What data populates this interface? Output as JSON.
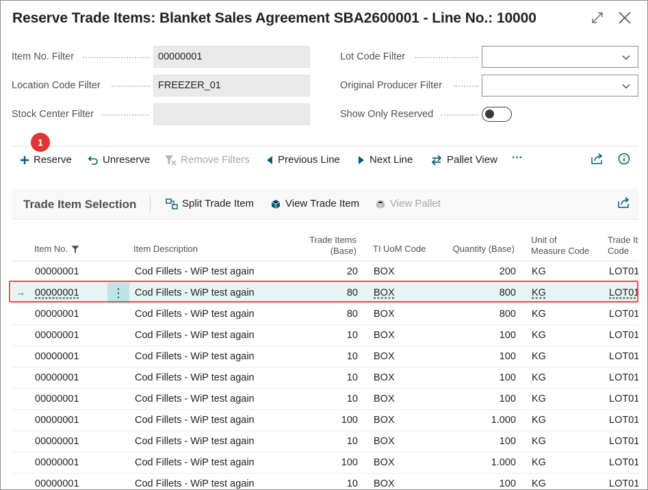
{
  "window": {
    "title": "Reserve Trade Items: Blanket Sales Agreement SBA2600001 - Line No.: 10000",
    "expand_icon": "expand-icon",
    "close_icon": "close-icon"
  },
  "filters": {
    "item_no": {
      "label": "Item No. Filter",
      "value": "00000001"
    },
    "location_code": {
      "label": "Location Code Filter",
      "value": "FREEZER_01"
    },
    "stock_center": {
      "label": "Stock Center Filter",
      "value": ""
    },
    "lot_code": {
      "label": "Lot Code Filter",
      "value": ""
    },
    "original_producer": {
      "label": "Original Producer Filter",
      "value": ""
    },
    "show_only_reserved": {
      "label": "Show Only Reserved",
      "value": false
    }
  },
  "badge": {
    "number": "1",
    "color": "#e03535"
  },
  "actions": {
    "reserve": "Reserve",
    "unreserve": "Unreserve",
    "remove_filters": "Remove Filters",
    "previous_line": "Previous Line",
    "next_line": "Next Line",
    "pallet_view": "Pallet View",
    "more": "···"
  },
  "part": {
    "title": "Trade Item Selection",
    "split_trade_item": "Split Trade Item",
    "view_trade_item": "View Trade Item",
    "view_pallet": "View Pallet"
  },
  "columns": {
    "item_no": "Item No.",
    "item_description": "Item Description",
    "trade_items_1": "Trade Items",
    "trade_items_2": "(Base)",
    "ti_uom_code": "TI UoM Code",
    "quantity_base": "Quantity (Base)",
    "uom_1": "Unit of",
    "uom_2": "Measure Code",
    "trade_item_code_1": "Trade Ite",
    "trade_item_code_2": "Code"
  },
  "rows": [
    {
      "item_no": "00000001",
      "description": "Cod Fillets - WiP test again",
      "trade_items": "20",
      "ti_uom": "BOX",
      "quantity": "200",
      "uom": "KG",
      "code": "LOT01"
    },
    {
      "item_no": "00000001",
      "description": "Cod Fillets - WiP test again",
      "trade_items": "80",
      "ti_uom": "BOX",
      "quantity": "800",
      "uom": "KG",
      "code": "LOT01",
      "selected": true
    },
    {
      "item_no": "00000001",
      "description": "Cod Fillets - WiP test again",
      "trade_items": "80",
      "ti_uom": "BOX",
      "quantity": "800",
      "uom": "KG",
      "code": "LOT01"
    },
    {
      "item_no": "00000001",
      "description": "Cod Fillets - WiP test again",
      "trade_items": "10",
      "ti_uom": "BOX",
      "quantity": "100",
      "uom": "KG",
      "code": "LOT01"
    },
    {
      "item_no": "00000001",
      "description": "Cod Fillets - WiP test again",
      "trade_items": "10",
      "ti_uom": "BOX",
      "quantity": "100",
      "uom": "KG",
      "code": "LOT01"
    },
    {
      "item_no": "00000001",
      "description": "Cod Fillets - WiP test again",
      "trade_items": "10",
      "ti_uom": "BOX",
      "quantity": "100",
      "uom": "KG",
      "code": "LOT01"
    },
    {
      "item_no": "00000001",
      "description": "Cod Fillets - WiP test again",
      "trade_items": "10",
      "ti_uom": "BOX",
      "quantity": "100",
      "uom": "KG",
      "code": "LOT01"
    },
    {
      "item_no": "00000001",
      "description": "Cod Fillets - WiP test again",
      "trade_items": "100",
      "ti_uom": "BOX",
      "quantity": "1.000",
      "uom": "KG",
      "code": "LOT01"
    },
    {
      "item_no": "00000001",
      "description": "Cod Fillets - WiP test again",
      "trade_items": "10",
      "ti_uom": "BOX",
      "quantity": "100",
      "uom": "KG",
      "code": "LOT01"
    },
    {
      "item_no": "00000001",
      "description": "Cod Fillets - WiP test again",
      "trade_items": "100",
      "ti_uom": "BOX",
      "quantity": "1.000",
      "uom": "KG",
      "code": "LOT01"
    },
    {
      "item_no": "00000001",
      "description": "Cod Fillets - WiP test again",
      "trade_items": "10",
      "ti_uom": "BOX",
      "quantity": "100",
      "uom": "KG",
      "code": "LOT01"
    }
  ],
  "colors": {
    "accent": "#005b70",
    "highlight": "#e15252",
    "selected_row": "#e8f3f5"
  }
}
